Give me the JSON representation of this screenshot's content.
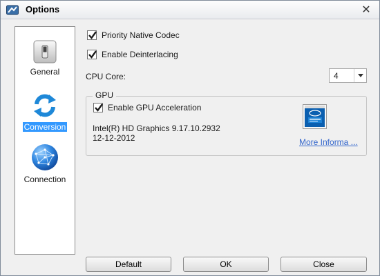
{
  "window": {
    "title": "Options",
    "close_glyph": "✕"
  },
  "sidebar": {
    "items": [
      {
        "label": "General",
        "icon": "switch-icon",
        "active": false
      },
      {
        "label": "Conversion",
        "icon": "refresh-arrows-icon",
        "active": true
      },
      {
        "label": "Connection",
        "icon": "globe-network-icon",
        "active": false
      }
    ]
  },
  "options": {
    "priority_native_codec": {
      "label": "Priority Native Codec",
      "checked": true
    },
    "enable_deinterlacing": {
      "label": "Enable Deinterlacing",
      "checked": true
    },
    "cpu_core": {
      "label": "CPU Core:",
      "value": "4"
    }
  },
  "gpu": {
    "group_label": "GPU",
    "enable_acceleration": {
      "label": "Enable GPU Acceleration",
      "checked": true
    },
    "device_name": "Intel(R) HD Graphics 9.17.10.2932",
    "driver_date": "12-12-2012",
    "more_info_link": "More Informa ...",
    "badge": {
      "icon": "intel-core-badge-icon"
    }
  },
  "buttons": {
    "default": "Default",
    "ok": "OK",
    "close": "Close"
  },
  "colors": {
    "accent": "#3399ff",
    "link": "#3366cc",
    "check": "#1a1a1a"
  }
}
